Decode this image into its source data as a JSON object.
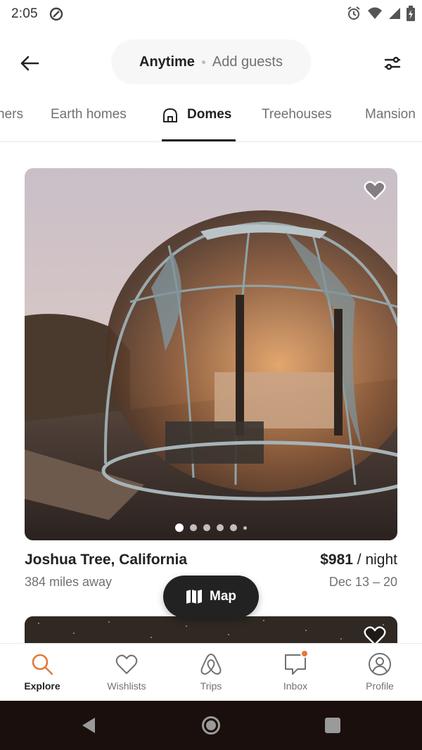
{
  "status_bar": {
    "time": "2:05",
    "icons": [
      "at-circle-icon",
      "alarm-icon",
      "wifi-icon",
      "signal-icon",
      "battery-icon"
    ]
  },
  "header": {
    "back_icon": "arrow-left-icon",
    "search_pill": {
      "date": "Anytime",
      "guests": "Add guests"
    },
    "filter_icon": "filter-sliders-icon"
  },
  "categories": [
    {
      "label": "ners",
      "active": false
    },
    {
      "label": "Earth homes",
      "active": false
    },
    {
      "label": "Domes",
      "active": true,
      "icon": "dome-icon"
    },
    {
      "label": "Treehouses",
      "active": false
    },
    {
      "label": "Mansion",
      "active": false
    }
  ],
  "listing": {
    "title": "Joshua Tree, California",
    "distance": "384 miles away",
    "price": "$981",
    "price_suffix": " / night",
    "dates": "Dec 13 – 20",
    "photo_count_dots": 6,
    "active_photo_index": 0
  },
  "map_button": {
    "label": "Map",
    "icon": "map-icon"
  },
  "bottom_nav": [
    {
      "label": "Explore",
      "icon": "search-icon",
      "active": true
    },
    {
      "label": "Wishlists",
      "icon": "heart-icon",
      "active": false
    },
    {
      "label": "Trips",
      "icon": "airbnb-logo-icon",
      "active": false
    },
    {
      "label": "Inbox",
      "icon": "message-icon",
      "active": false,
      "badge": true
    },
    {
      "label": "Profile",
      "icon": "profile-icon",
      "active": false
    }
  ],
  "colors": {
    "accent": "#e07b39",
    "text": "#222222",
    "muted": "#717171"
  }
}
